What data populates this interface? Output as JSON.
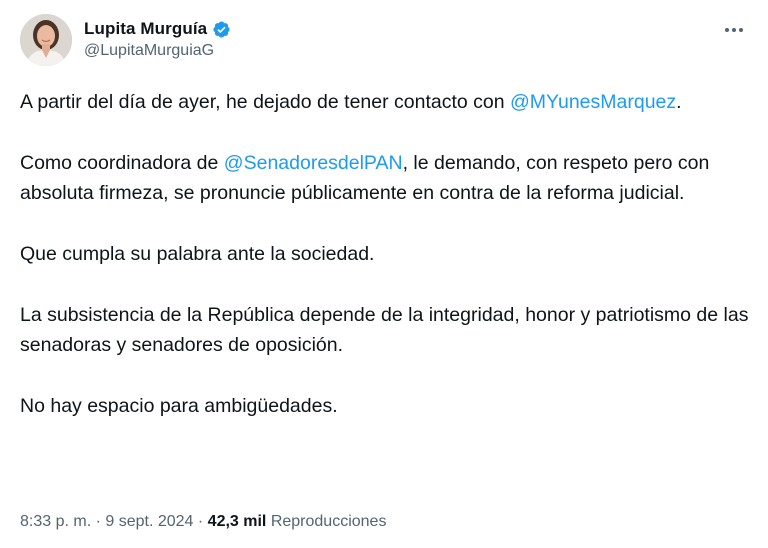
{
  "author": {
    "display_name": "Lupita Murguía",
    "handle": "@LupitaMurguiaG",
    "verified": true,
    "avatar_icon": "profile-photo",
    "verified_color": "#1d9bf0"
  },
  "menu": {
    "icon": "more-options-icon"
  },
  "tweet": {
    "paragraphs": [
      [
        {
          "type": "text",
          "value": "A partir del día de ayer, he dejado de tener contacto con "
        },
        {
          "type": "mention",
          "value": "@MYunesMarquez"
        },
        {
          "type": "text",
          "value": "."
        }
      ],
      [
        {
          "type": "text",
          "value": "Como coordinadora de "
        },
        {
          "type": "mention",
          "value": "@SenadoresdelPAN"
        },
        {
          "type": "text",
          "value": ", le demando, con respeto pero con absoluta firmeza, se pronuncie públicamente en contra de la reforma judicial."
        }
      ],
      [
        {
          "type": "text",
          "value": "Que cumpla su palabra ante la sociedad."
        }
      ],
      [
        {
          "type": "text",
          "value": "La subsistencia de la República depende de la integridad, honor y patriotismo de las senadoras y senadores de oposición."
        }
      ],
      [
        {
          "type": "text",
          "value": "No hay espacio para ambigüedades."
        }
      ]
    ]
  },
  "meta": {
    "time": "8:33 p. m.",
    "separator": " · ",
    "date": "9 sept. 2024",
    "views_count": "42,3 mil",
    "views_label": "Reproducciones"
  },
  "colors": {
    "text": "#0f1419",
    "secondary": "#536471",
    "link": "#1d9bf0"
  }
}
